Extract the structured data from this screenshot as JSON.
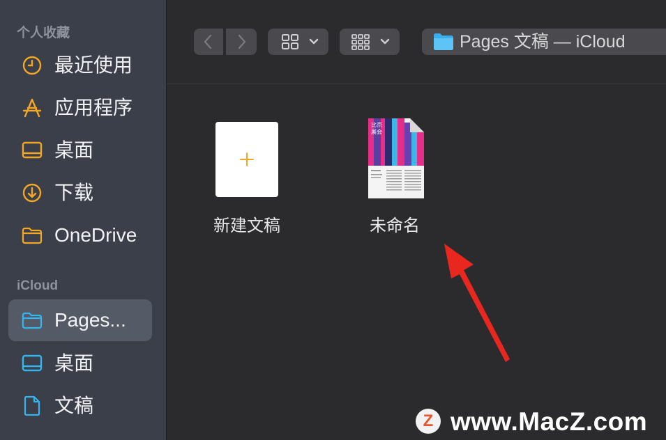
{
  "sidebar": {
    "favorites_header": "个人收藏",
    "favorites": [
      {
        "label": "最近使用",
        "icon": "clock-icon"
      },
      {
        "label": "应用程序",
        "icon": "applications-icon"
      },
      {
        "label": "桌面",
        "icon": "desktop-icon"
      },
      {
        "label": "下载",
        "icon": "download-icon"
      },
      {
        "label": "OneDrive",
        "icon": "folder-icon"
      }
    ],
    "icloud_header": "iCloud",
    "icloud": [
      {
        "label": "Pages...",
        "icon": "folder-icon",
        "selected": true
      },
      {
        "label": "桌面",
        "icon": "desktop-icon"
      },
      {
        "label": "文稿",
        "icon": "document-icon"
      }
    ]
  },
  "toolbar": {
    "back_icon": "chevron-left-icon",
    "forward_icon": "chevron-right-icon",
    "view_icon": "grid-view-icon",
    "group_icon": "group-icon",
    "path_label": "Pages 文稿 — iCloud"
  },
  "files": [
    {
      "name": "新建文稿",
      "icon": "plus-icon"
    },
    {
      "name": "未命名",
      "thumbnail_text": "比京展会"
    }
  ],
  "watermark": {
    "logo": "Z",
    "text": "www.MacZ.com"
  },
  "colors": {
    "accent_orange": "#f5a623",
    "accent_blue": "#33b5f0",
    "arrow_red": "#e8281f"
  }
}
